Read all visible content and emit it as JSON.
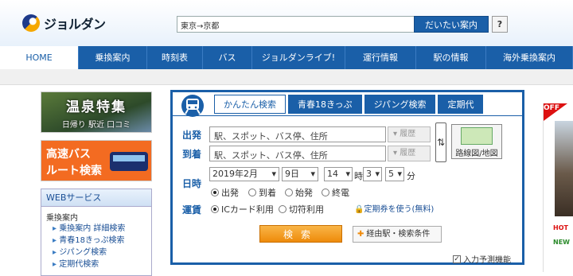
{
  "header": {
    "logo_text": "ジョルダン",
    "search_value": "東京→京都",
    "search_button": "だいたい案内",
    "help_label": "?"
  },
  "nav": {
    "items": [
      "HOME",
      "乗換案内",
      "時刻表",
      "バス",
      "ジョルダンライブ!",
      "運行情報",
      "駅の情報",
      "海外乗換案内"
    ]
  },
  "left": {
    "onsen_title": "温泉特集",
    "onsen_sub": "日帰り 駅近 口コミ",
    "bus_line1": "高速バス",
    "bus_line2": "ルート検索",
    "web_header": "WEBサービス",
    "web_section": "乗換案内",
    "web_links": [
      "乗換案内 詳細検索",
      "青春18きっぷ検索",
      "ジパング検索",
      "定期代検索"
    ]
  },
  "route": {
    "tabs": [
      "かんたん検索",
      "青春18きっぷ",
      "ジパング検索",
      "定期代"
    ],
    "from_label": "出発",
    "to_label": "到着",
    "date_label": "日時",
    "fare_label": "運賃",
    "from_placeholder": "駅、スポット、バス停、住所",
    "to_placeholder": "駅、スポット、バス停、住所",
    "history_label": "履歴",
    "swap_icon": "⇅",
    "map_button": "路線図/地図",
    "year_month": "2019年2月",
    "day": "9日",
    "hour": "14",
    "hour_unit": "時",
    "min1": "3",
    "min2": "5",
    "min_unit": "分",
    "time_options": [
      "出発",
      "到着",
      "始発",
      "終電"
    ],
    "fare_options": [
      "ICカード利用",
      "切符利用"
    ],
    "teiki_link": "定期券を使う(無料)",
    "search_button": "検索",
    "via_button": "経由駅・検索条件",
    "predict_label": "入力予測機能"
  },
  "ad": {
    "off_badge": "OFF",
    "hot_label": "HOT",
    "new_label": "NEW"
  }
}
